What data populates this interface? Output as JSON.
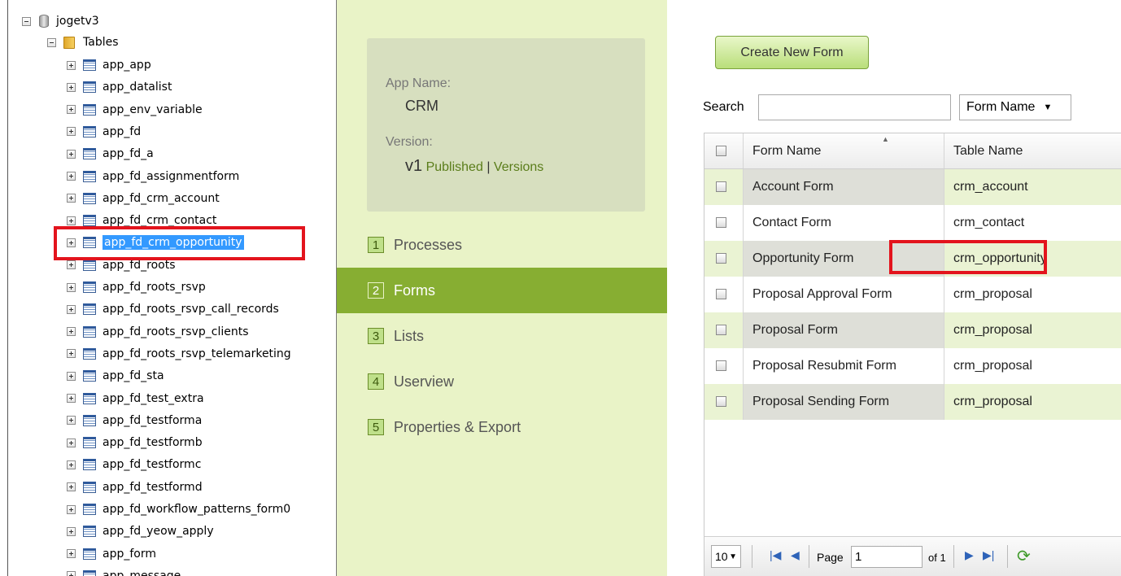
{
  "tree": {
    "database": "jogetv3",
    "tables_folder": "Tables",
    "tables": [
      "app_app",
      "app_datalist",
      "app_env_variable",
      "app_fd",
      "app_fd_a",
      "app_fd_assignmentform",
      "app_fd_crm_account",
      "app_fd_crm_contact",
      "app_fd_crm_opportunity",
      "app_fd_roots",
      "app_fd_roots_rsvp",
      "app_fd_roots_rsvp_call_records",
      "app_fd_roots_rsvp_clients",
      "app_fd_roots_rsvp_telemarketing",
      "app_fd_sta",
      "app_fd_test_extra",
      "app_fd_testforma",
      "app_fd_testformb",
      "app_fd_testformc",
      "app_fd_testformd",
      "app_fd_workflow_patterns_form0",
      "app_fd_yeow_apply",
      "app_form",
      "app_message"
    ],
    "selected": "app_fd_crm_opportunity"
  },
  "app": {
    "name_label": "App Name:",
    "name": "CRM",
    "version_label": "Version:",
    "version": "v1",
    "published": "Published",
    "separator": "|",
    "versions_link": "Versions"
  },
  "nav": [
    {
      "num": "1",
      "label": "Processes"
    },
    {
      "num": "2",
      "label": "Forms",
      "active": true
    },
    {
      "num": "3",
      "label": "Lists"
    },
    {
      "num": "4",
      "label": "Userview"
    },
    {
      "num": "5",
      "label": "Properties & Export"
    }
  ],
  "forms_panel": {
    "create_button": "Create New Form",
    "search_label": "Search",
    "search_value": "",
    "search_field": "Form Name",
    "columns": [
      "Form Name",
      "Table Name"
    ],
    "rows": [
      {
        "form": "Account Form",
        "table": "crm_account"
      },
      {
        "form": "Contact Form",
        "table": "crm_contact"
      },
      {
        "form": "Opportunity Form",
        "table": "crm_opportunity"
      },
      {
        "form": "Proposal Approval Form",
        "table": "crm_proposal"
      },
      {
        "form": "Proposal Form",
        "table": "crm_proposal"
      },
      {
        "form": "Proposal Resubmit Form",
        "table": "crm_proposal"
      },
      {
        "form": "Proposal Sending Form",
        "table": "crm_proposal"
      }
    ],
    "pager": {
      "page_size": "10",
      "page_label": "Page",
      "page": "1",
      "of_label": "of 1"
    }
  },
  "colors": {
    "accent": "#87ae32",
    "nav_bg": "#e9f3c7",
    "highlight_box": "#e3141d",
    "selection": "#3399ff"
  }
}
